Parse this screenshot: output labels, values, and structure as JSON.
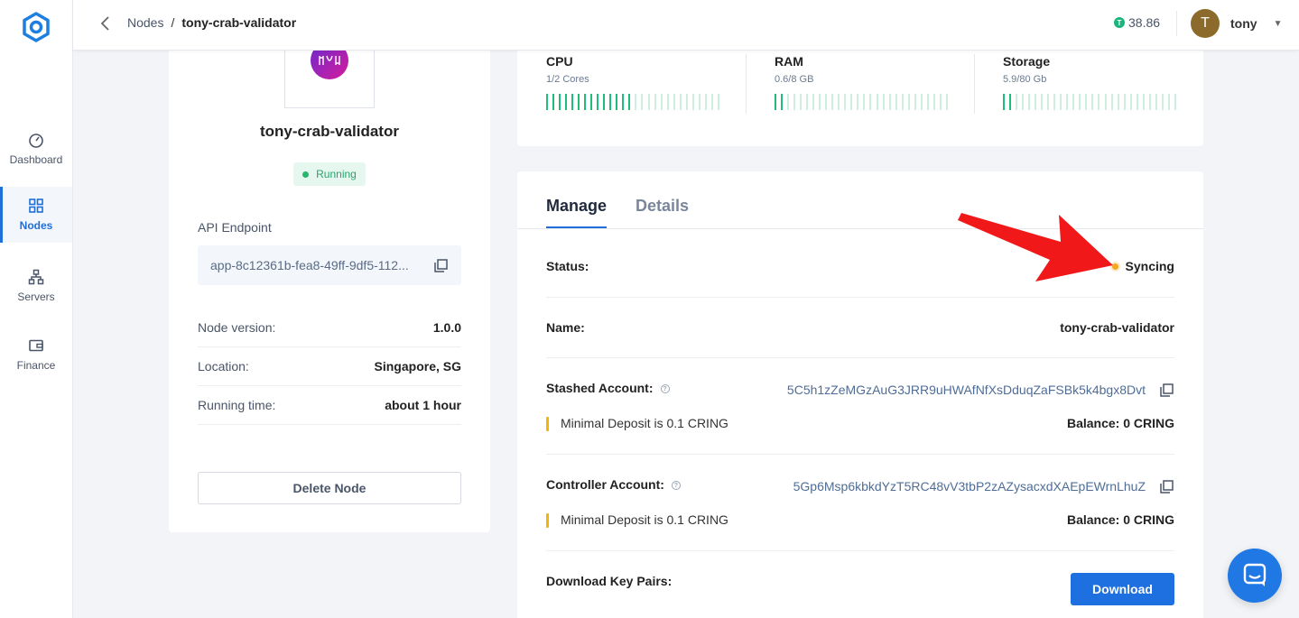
{
  "sidebar": {
    "items": [
      {
        "label": "Dashboard",
        "icon": "gauge-icon"
      },
      {
        "label": "Nodes",
        "icon": "grid-icon",
        "active": true
      },
      {
        "label": "Servers",
        "icon": "network-icon"
      },
      {
        "label": "Finance",
        "icon": "wallet-icon"
      }
    ]
  },
  "header": {
    "breadcrumb_root": "Nodes",
    "breadcrumb_sep": "/",
    "breadcrumb_current": "tony-crab-validator",
    "balance": "38.86",
    "balance_coin": "T",
    "user_initial": "T",
    "user_name": "tony"
  },
  "node": {
    "name": "tony-crab-validator",
    "status": "Running",
    "api_label": "API Endpoint",
    "api_value": "app-8c12361b-fea8-49ff-9df5-112...",
    "details": [
      {
        "key": "Node version:",
        "value": "1.0.0"
      },
      {
        "key": "Location:",
        "value": "Singapore, SG"
      },
      {
        "key": "Running time:",
        "value": "about 1 hour"
      }
    ],
    "delete_label": "Delete Node"
  },
  "resources": [
    {
      "title": "CPU",
      "subtitle": "1/2 Cores",
      "fill": 0.5
    },
    {
      "title": "RAM",
      "subtitle": "0.6/8 GB",
      "fill": 0.075
    },
    {
      "title": "Storage",
      "subtitle": "5.9/80 Gb",
      "fill": 0.074
    }
  ],
  "manage": {
    "tabs": [
      "Manage",
      "Details"
    ],
    "status_label": "Status:",
    "status_value": "Syncing",
    "name_label": "Name:",
    "name_value": "tony-crab-validator",
    "stashed_label": "Stashed Account:",
    "stashed_address": "5C5h1zZeMGzAuG3JRR9uHWAfNfXsDduqZaFSBk5k4bgx8Dvt",
    "stashed_note": "Minimal Deposit is 0.1 CRING",
    "stashed_balance": "Balance: 0 CRING",
    "controller_label": "Controller Account:",
    "controller_address": "5Gp6Msp6kbkdYzT5RC48vV3tbP2zAZysacxdXAEpEWrnLhuZ",
    "controller_note": "Minimal Deposit is 0.1 CRING",
    "controller_balance": "Balance: 0 CRING",
    "download_label": "Download Key Pairs:",
    "download_button": "Download"
  },
  "colors": {
    "accent": "#1e6fd9",
    "running": "#27b56f",
    "syncing": "#f5a623",
    "arrow": "#f01818"
  }
}
